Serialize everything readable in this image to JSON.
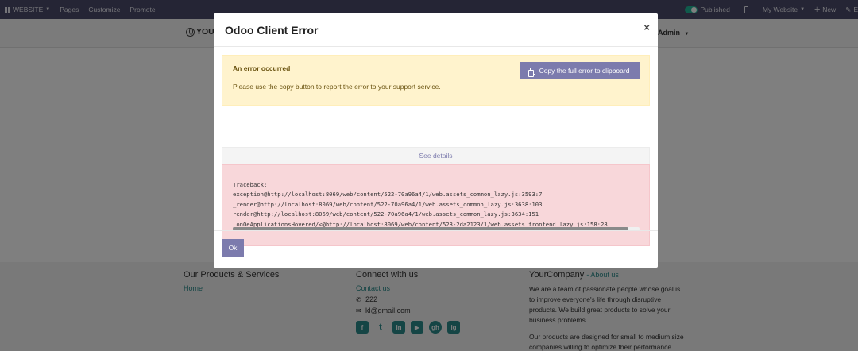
{
  "topbar": {
    "website_label": "WEBSITE",
    "pages_label": "Pages",
    "customize_label": "Customize",
    "promote_label": "Promote",
    "published_label": "Published",
    "my_website_label": "My Website",
    "new_label": "New",
    "edit_label": "E"
  },
  "header": {
    "logo_text": "YOU",
    "admin_label": "Admin"
  },
  "modal": {
    "title": "Odoo Client Error",
    "close_symbol": "×",
    "alert_title": "An error occurred",
    "alert_text": "Please use the copy button to report the error to your support service.",
    "copy_button": "Copy the full error to clipboard",
    "see_details": "See details",
    "traceback": "Traceback:\nexception@http://localhost:8069/web/content/522-70a96a4/1/web.assets_common_lazy.js:3593:7\n_render@http://localhost:8069/web/content/522-70a96a4/1/web.assets_common_lazy.js:3638:103\nrender@http://localhost:8069/web/content/522-70a96a4/1/web.assets_common_lazy.js:3634:151\n_onOeApplicationsHovered/<@http://localhost:8069/web/content/523-2da2123/1/web.assets_frontend_lazy.js:158:28",
    "ok_button": "Ok"
  },
  "footer": {
    "col1_title": "Our Products & Services",
    "col1_link": "Home",
    "col2_title": "Connect with us",
    "contact_link": "Contact us",
    "phone": "222",
    "email": "kl@gmail.com",
    "col3_title": "YourCompany",
    "col3_about": "- About us",
    "para1": "We are a team of passionate people whose goal is to improve everyone's life through disruptive products. We build great products to solve your business problems.",
    "para2": "Our products are designed for small to medium size companies willing to optimize their performance.",
    "social": [
      "f",
      "t",
      "in",
      "▶",
      "gh",
      "ig"
    ]
  },
  "colors": {
    "topbar": "#4b4b6b",
    "primary": "#7c7bad",
    "teal": "#2a8a8a",
    "alert_bg": "#fff3cd",
    "error_bg": "#f8d7da"
  }
}
